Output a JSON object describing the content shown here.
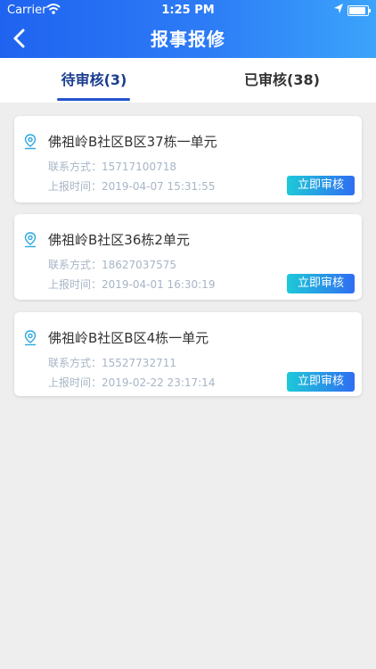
{
  "status_bar": {
    "carrier": "Carrier",
    "time": "1:25 PM",
    "battery_level": 0.9
  },
  "header": {
    "title": "报事报修",
    "back_icon": "chevron-left-icon"
  },
  "tabs": [
    {
      "label": "待审核(3)",
      "active": true
    },
    {
      "label": "已审核(38)",
      "active": false
    }
  ],
  "colors": {
    "primary": "#2453cf",
    "header_start": "#1f63f0",
    "header_end": "#3ba4fb",
    "button_start": "#1ec9d8",
    "button_end": "#2f6df2",
    "muted_text": "#a7b5c6"
  },
  "items": [
    {
      "address": "佛祖岭B社区B区37栋一单元",
      "contact": "联系方式：15717100718",
      "reported": "上报时间：2019-04-07 15:31:55",
      "action": "立即审核"
    },
    {
      "address": "佛祖岭B社区36栋2单元",
      "contact": "联系方式：18627037575",
      "reported": "上报时间：2019-04-01 16:30:19",
      "action": "立即审核"
    },
    {
      "address": "佛祖岭B社区B区4栋一单元",
      "contact": "联系方式：15527732711",
      "reported": "上报时间：2019-02-22 23:17:14",
      "action": "立即审核"
    }
  ]
}
